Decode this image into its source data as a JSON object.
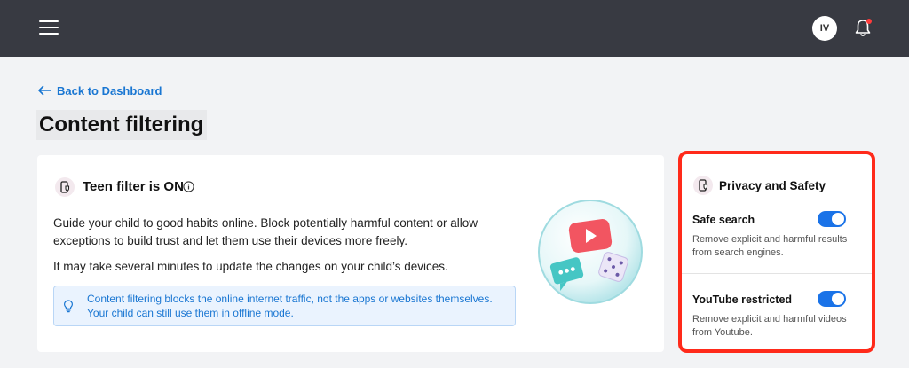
{
  "header": {
    "avatar_initials": "IV",
    "notification_dot_color": "#ff3b3b",
    "background_color": "#383a42"
  },
  "nav": {
    "back_label": "Back to Dashboard"
  },
  "page": {
    "title": "Content filtering"
  },
  "filter_card": {
    "title": "Teen filter is ON",
    "description": "Guide your child to good habits online. Block potentially harmful content or allow exceptions to build trust and let them use their devices more freely.",
    "update_note": "It may take several minutes to update the changes on your child’s devices.",
    "info_box": "Content filtering blocks the online internet traffic, not the apps or websites themselves. Your child can still use them in offline mode."
  },
  "privacy_card": {
    "title": "Privacy and Safety",
    "highlight_color": "#ff2a1a",
    "options": [
      {
        "title": "Safe search",
        "description": "Remove explicit and harmful results from search engines.",
        "enabled": true
      },
      {
        "title": "YouTube restricted",
        "description": "Remove explicit and harmful videos from Youtube.",
        "enabled": true
      }
    ]
  },
  "colors": {
    "accent": "#1a73e8",
    "link": "#1976d2"
  },
  "icons": [
    "menu-icon",
    "bell-icon",
    "arrow-left-icon",
    "phone-shield-icon",
    "info-icon",
    "lightbulb-icon"
  ]
}
